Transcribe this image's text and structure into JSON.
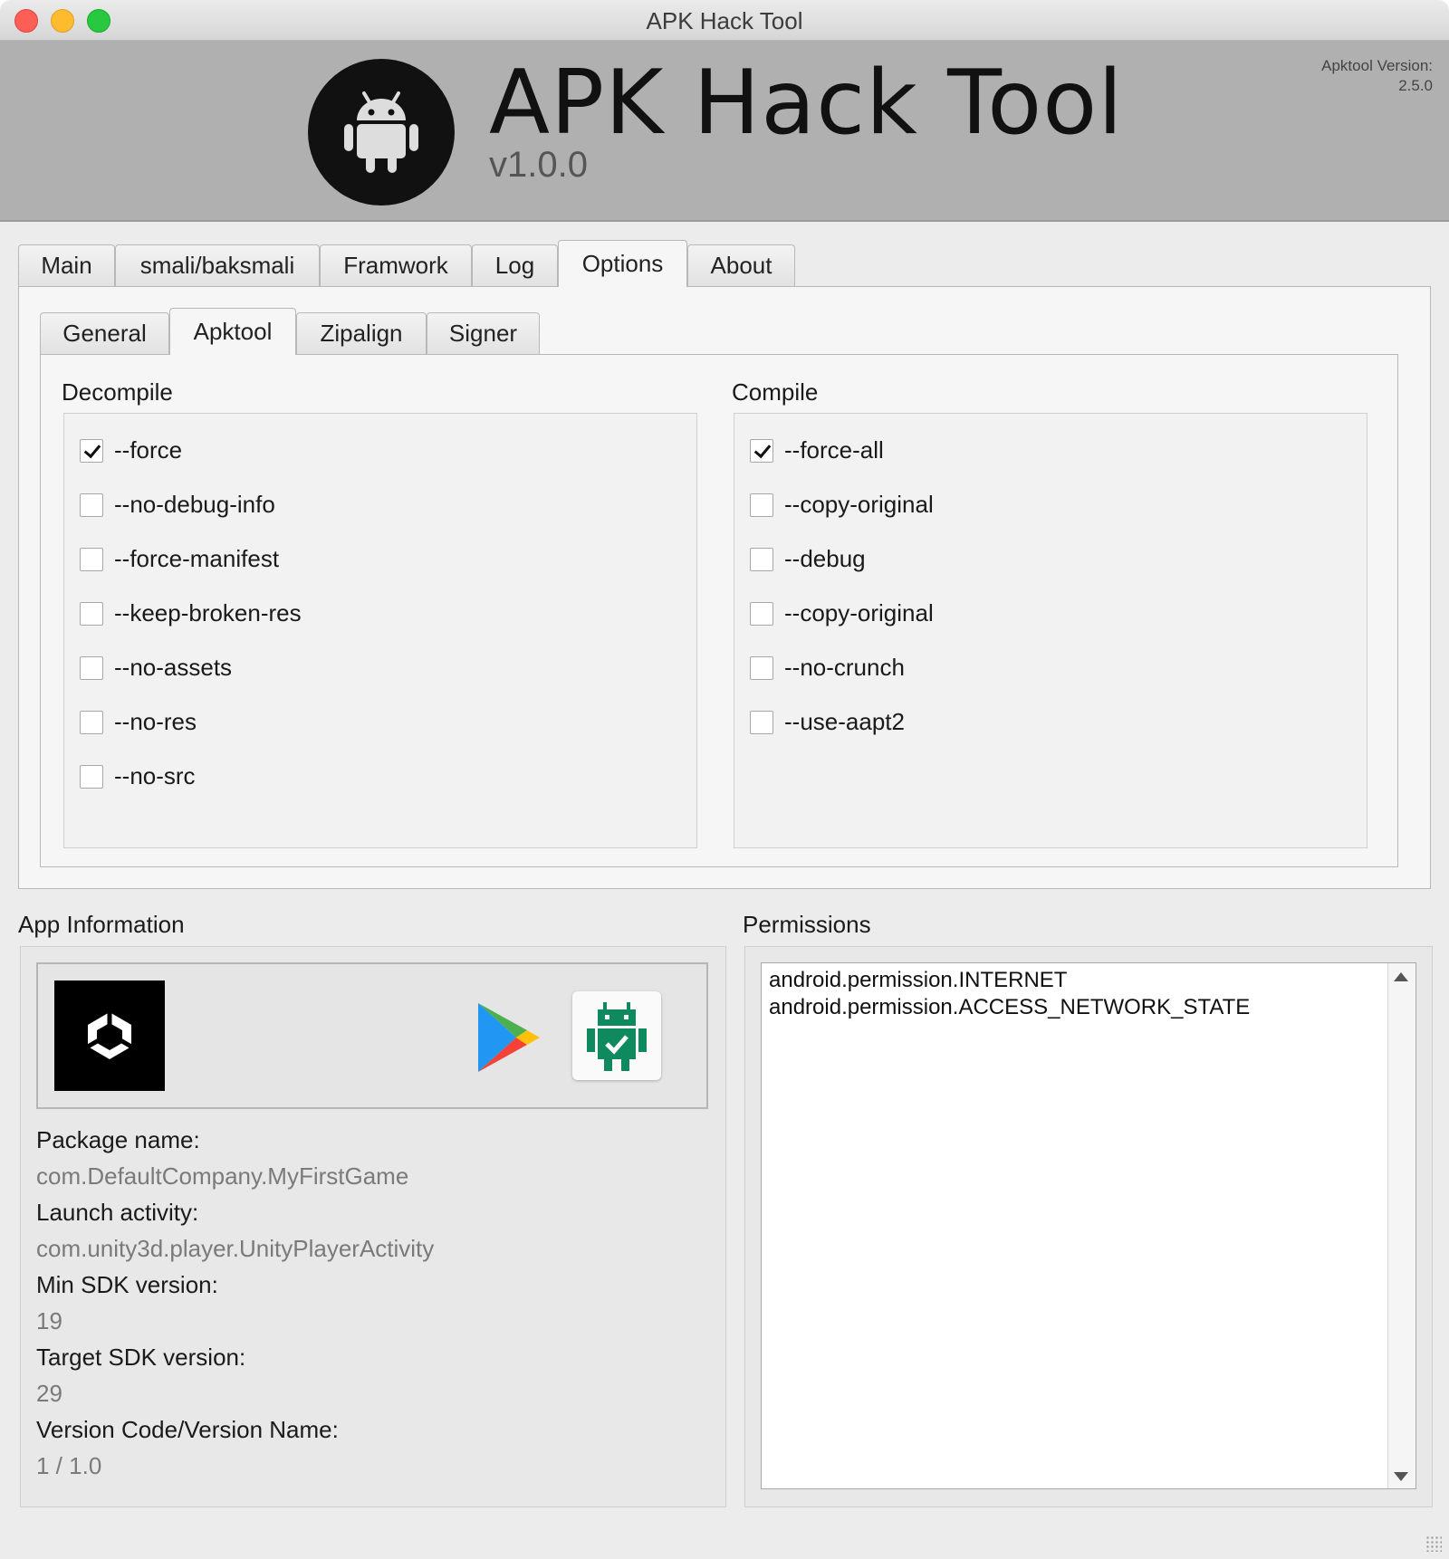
{
  "window": {
    "title": "APK Hack Tool"
  },
  "header": {
    "app_name": "APK Hack Tool",
    "app_version": "v1.0.0",
    "apktool_version_label": "Apktool Version:",
    "apktool_version_value": "2.5.0"
  },
  "tabs": [
    {
      "label": "Main"
    },
    {
      "label": "smali/baksmali"
    },
    {
      "label": "Framwork"
    },
    {
      "label": "Log"
    },
    {
      "label": "Options",
      "active": true
    },
    {
      "label": "About"
    }
  ],
  "subtabs": [
    {
      "label": "General"
    },
    {
      "label": "Apktool",
      "active": true
    },
    {
      "label": "Zipalign"
    },
    {
      "label": "Signer"
    }
  ],
  "decompile": {
    "title": "Decompile",
    "options": [
      {
        "label": "--force",
        "checked": true
      },
      {
        "label": "--no-debug-info",
        "checked": false
      },
      {
        "label": "--force-manifest",
        "checked": false
      },
      {
        "label": "--keep-broken-res",
        "checked": false
      },
      {
        "label": "--no-assets",
        "checked": false
      },
      {
        "label": "--no-res",
        "checked": false
      },
      {
        "label": "--no-src",
        "checked": false
      }
    ]
  },
  "compile": {
    "title": "Compile",
    "options": [
      {
        "label": "--force-all",
        "checked": true
      },
      {
        "label": "--copy-original",
        "checked": false
      },
      {
        "label": "--debug",
        "checked": false
      },
      {
        "label": "--copy-original",
        "checked": false
      },
      {
        "label": "--no-crunch",
        "checked": false
      },
      {
        "label": "--use-aapt2",
        "checked": false
      }
    ]
  },
  "app_info": {
    "title": "App Information",
    "icons": [
      "unity-icon",
      "google-play-icon",
      "android-badge-icon"
    ],
    "package_name_label": "Package name:",
    "package_name": "com.DefaultCompany.MyFirstGame",
    "launch_activity_label": "Launch activity:",
    "launch_activity": "com.unity3d.player.UnityPlayerActivity",
    "min_sdk_label": "Min SDK version:",
    "min_sdk": "19",
    "target_sdk_label": "Target SDK version:",
    "target_sdk": "29",
    "version_label": "Version Code/Version Name:",
    "version": "1 / 1.0"
  },
  "permissions": {
    "title": "Permissions",
    "items": [
      "android.permission.INTERNET",
      "android.permission.ACCESS_NETWORK_STATE"
    ]
  },
  "colors": {
    "banner": "#b0b0b0",
    "android_green": "#0f8a5f",
    "close": "#fd5f57",
    "minimize": "#febb2e",
    "maximize": "#28c840"
  }
}
